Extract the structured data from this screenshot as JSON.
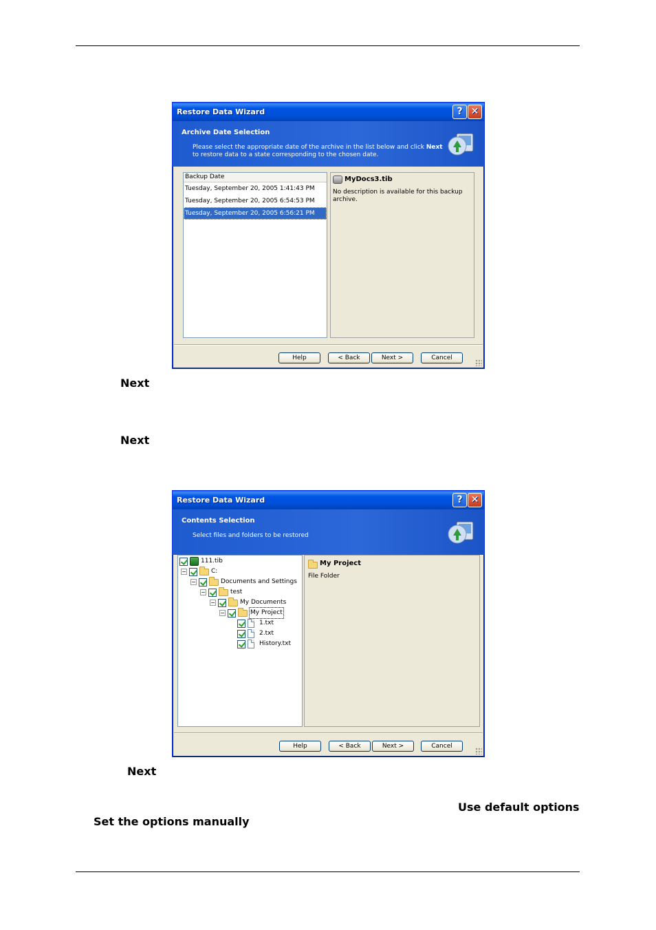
{
  "page": {
    "next_1": "Next",
    "next_2": "Next",
    "next_3": "Next",
    "use_default_options": "Use default options",
    "set_options_manually": "Set the options manually"
  },
  "dialog1": {
    "title": "Restore Data Wizard",
    "help_glyph": "?",
    "close_glyph": "✕",
    "banner_title": "Archive Date Selection",
    "banner_desc_pre": "Please select the appropriate date of the archive in the list below and click ",
    "banner_desc_bold": "Next",
    "banner_desc_post": " to restore data to a state corresponding to the chosen date.",
    "list_header": "Backup Date",
    "rows": [
      "Tuesday, September 20, 2005 1:41:43 PM",
      "Tuesday, September 20, 2005 6:54:53 PM",
      "Tuesday, September 20, 2005 6:56:21 PM"
    ],
    "selected_row": 2,
    "info_title": "MyDocs3.tib",
    "info_text": "No description is available for this backup archive.",
    "buttons": {
      "help": "Help",
      "back": "< Back",
      "next": "Next >",
      "cancel": "Cancel"
    }
  },
  "dialog2": {
    "title": "Restore Data Wizard",
    "help_glyph": "?",
    "close_glyph": "✕",
    "banner_title": "Contents Selection",
    "banner_desc": "Select files and folders to be restored",
    "tree": {
      "root": "111.tib",
      "drive": "C:",
      "docs_settings": "Documents and Settings",
      "test": "test",
      "my_documents": "My Documents",
      "my_project": "My Project",
      "file1": "1.txt",
      "file2": "2.txt",
      "file3": "History.txt",
      "expander": "−"
    },
    "info_title": "My Project",
    "info_text": "File Folder",
    "buttons": {
      "help": "Help",
      "back": "< Back",
      "next": "Next >",
      "cancel": "Cancel"
    }
  }
}
